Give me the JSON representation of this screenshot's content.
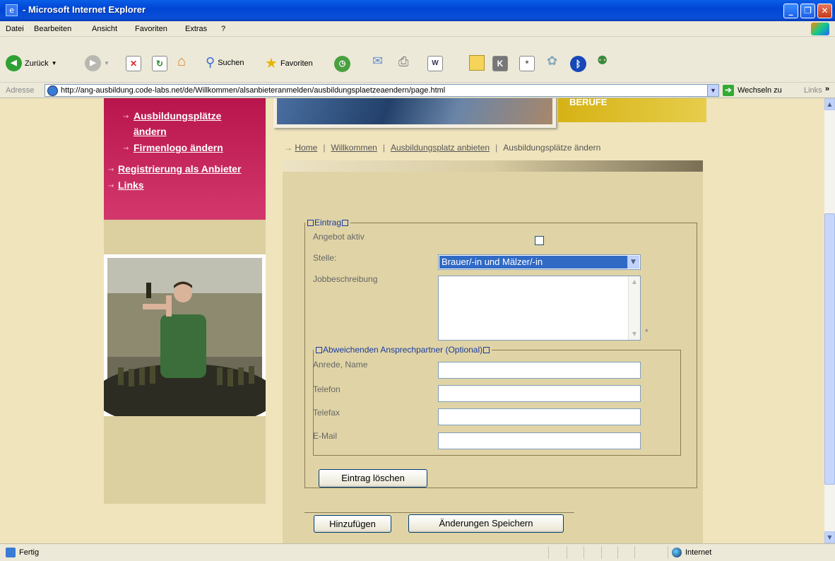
{
  "window": {
    "title": "- Microsoft Internet Explorer"
  },
  "menu": [
    "Datei",
    "Bearbeiten",
    "Ansicht",
    "Favoriten",
    "Extras",
    "?"
  ],
  "toolbar": {
    "back": "Zurück",
    "search": "Suchen",
    "favorites": "Favoriten"
  },
  "address": {
    "label": "Adresse",
    "url": "http://ang-ausbildung.code-labs.net/de/Willkommen/alsanbieteranmelden/ausbildungsplaetzeaendern/page.html",
    "go": "Wechseln zu",
    "links": "Links",
    "chevron": "»"
  },
  "sidenav": {
    "item1_line1": "Ausbildungsplätze",
    "item1_line2": "ändern",
    "item2": "Firmenlogo ändern",
    "item3": "Registrierung als Anbieter",
    "item4": "Links"
  },
  "banner": {
    "right_text": "BERUFE"
  },
  "breadcrumb": {
    "home": "Home",
    "welcome": "Willkommen",
    "offer": "Ausbildungsplatz anbieten",
    "current": "Ausbildungsplätze ändern"
  },
  "form": {
    "legend_entry": "Eintrag",
    "active_label": "Angebot aktiv",
    "active_checked": false,
    "position_label": "Stelle:",
    "position_value": "Brauer/-in und Mälzer/-in",
    "job_desc_label": "Jobbeschreibung",
    "job_desc_value": "",
    "required_mark": "*",
    "legend_contact": "Abweichenden Ansprechpartner (Optional)",
    "contact_name_label": "Anrede, Name",
    "phone_label": "Telefon",
    "fax_label": "Telefax",
    "email_label": "E-Mail",
    "delete_button": "Eintrag löschen",
    "add_button": "Hinzufügen",
    "save_button": "Änderungen Speichern"
  },
  "statusbar": {
    "left": "Fertig",
    "zone": "Internet"
  }
}
